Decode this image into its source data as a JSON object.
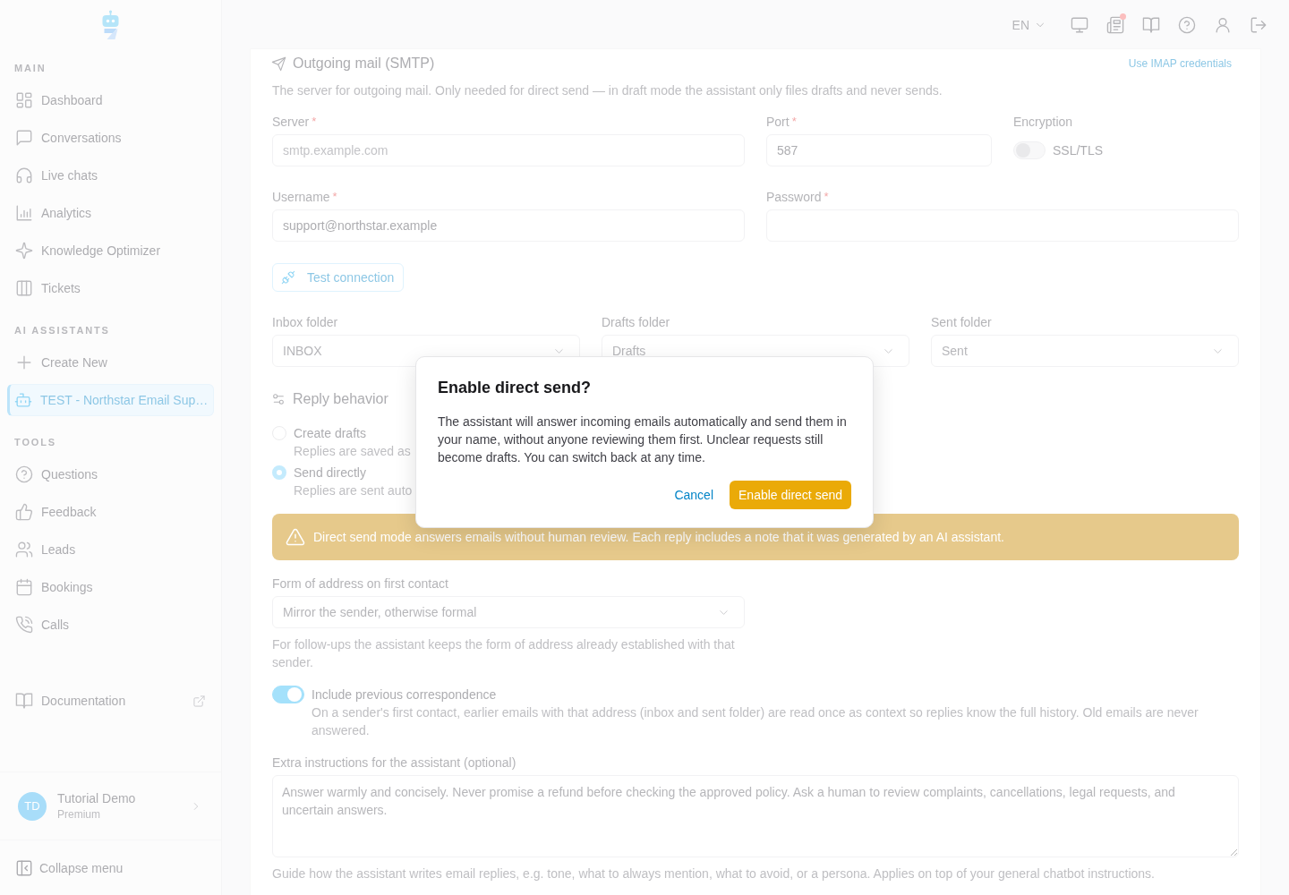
{
  "sidebar": {
    "sections": [
      {
        "title": "MAIN",
        "items": [
          {
            "label": "Dashboard",
            "selected": false
          },
          {
            "label": "Conversations",
            "selected": false
          },
          {
            "label": "Live chats",
            "selected": false
          },
          {
            "label": "Analytics",
            "selected": false
          },
          {
            "label": "Knowledge Optimizer",
            "selected": false
          },
          {
            "label": "Tickets",
            "selected": false
          }
        ]
      },
      {
        "title": "AI ASSISTANTS",
        "items": [
          {
            "label": "Create New",
            "selected": false
          },
          {
            "label": "TEST - Northstar Email Sup…",
            "selected": true
          }
        ]
      },
      {
        "title": "TOOLS",
        "items": [
          {
            "label": "Questions",
            "selected": false
          },
          {
            "label": "Feedback",
            "selected": false
          },
          {
            "label": "Leads",
            "selected": false
          },
          {
            "label": "Bookings",
            "selected": false
          },
          {
            "label": "Calls",
            "selected": false
          }
        ]
      }
    ],
    "documentation": "Documentation",
    "user": {
      "initials": "TD",
      "name": "Tutorial Demo",
      "plan": "Premium"
    },
    "collapse": "Collapse menu"
  },
  "topbar": {
    "language": "EN",
    "icon_buttons": [
      {
        "badge": false
      },
      {
        "badge": true
      },
      {
        "badge": false
      },
      {
        "badge": false
      },
      {
        "badge": false
      },
      {
        "badge": false
      }
    ]
  },
  "smtp": {
    "title": "Outgoing mail (SMTP)",
    "link": "Use IMAP credentials",
    "description": "The server for outgoing mail. Only needed for direct send — in draft mode the assistant only files drafts and never sends.",
    "rows": [
      [
        {
          "kind": "input",
          "label": "Server",
          "required_mark": "*",
          "placeholder": "smtp.example.com"
        },
        {
          "kind": "input",
          "label": "Port",
          "required_mark": "*",
          "value": "587"
        },
        {
          "kind": "toggle",
          "label": "Encryption",
          "on": false,
          "toggle_label": "SSL/TLS"
        }
      ],
      [
        {
          "kind": "input",
          "label": "Username",
          "required_mark": "*",
          "value": "support@northstar.example"
        },
        {
          "kind": "password",
          "label": "Password",
          "required_mark": "*"
        }
      ]
    ],
    "test_button": "Test connection"
  },
  "folders": [
    {
      "label": "Inbox folder",
      "value": "INBOX"
    },
    {
      "label": "Drafts folder",
      "value": "Drafts"
    },
    {
      "label": "Sent folder",
      "value": "Sent"
    }
  ],
  "reply_behavior": {
    "title": "Reply behavior",
    "options": [
      {
        "label": "Create drafts",
        "description": "Replies are saved as",
        "selected": false
      },
      {
        "label": "Send directly",
        "description": "Replies are sent auto",
        "selected": true
      }
    ],
    "warning": "Direct send mode answers emails without human review. Each reply includes a note that it was generated by an AI assistant.",
    "address": {
      "label": "Form of address on first contact",
      "value": "Mirror the sender, otherwise formal",
      "hint": "For follow-ups the assistant keeps the form of address already established with that sender."
    },
    "history": {
      "label": "Include previous correspondence",
      "on": true,
      "description": "On a sender's first contact, earlier emails with that address (inbox and sent folder) are read once as context so replies know the full history. Old emails are never answered."
    },
    "instructions": {
      "label": "Extra instructions for the assistant (optional)",
      "value": "Answer warmly and concisely. Never promise a refund before checking the approved policy. Ask a human to review complaints, cancellations, legal requests, and uncertain answers.",
      "hint": "Guide how the assistant writes email replies, e.g. tone, what to always mention, what to avoid, or a persona. Applies on top of your general chatbot instructions."
    }
  },
  "dialog": {
    "title": "Enable direct send?",
    "message": "The assistant will answer incoming emails automatically and send them in your name, without anyone reviewing them first. Unclear requests still become drafts. You can switch back at any time.",
    "cancel": "Cancel",
    "confirm": "Enable direct send"
  }
}
